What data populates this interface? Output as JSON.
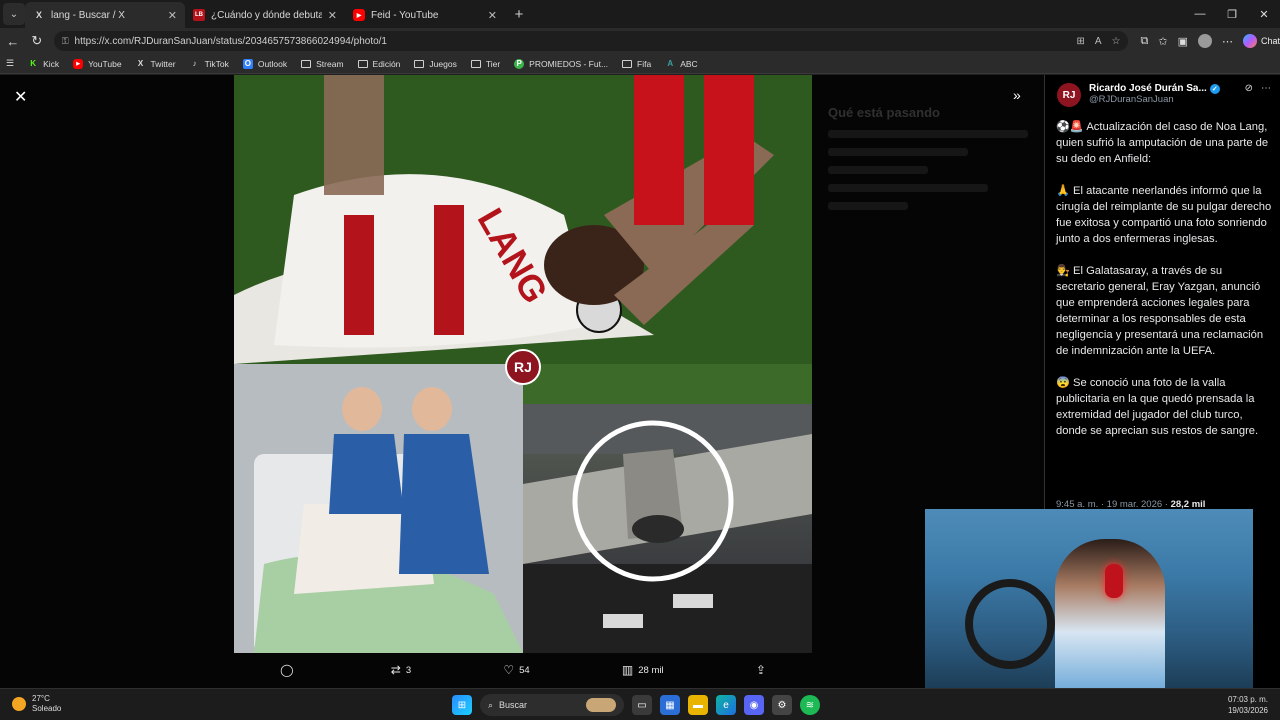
{
  "browser": {
    "tabs": [
      {
        "favicon": "x-logo-icon",
        "fav_text": "X",
        "title": "lang - Buscar / X",
        "active": true
      },
      {
        "favicon": "site-icon",
        "fav_text": "LB",
        "title": "¿Cuándo y dónde debutaría River",
        "active": false
      },
      {
        "favicon": "youtube-icon",
        "fav_text": "▶",
        "title": "Feid - YouTube",
        "active": false
      }
    ],
    "url": "https://x.com/RJDuranSanJuan/status/2034657573866024994/photo/1",
    "copilot_label": "Chat"
  },
  "bookmarks": [
    {
      "label": "Kick",
      "icon": "K",
      "color": "#53fc18"
    },
    {
      "label": "YouTube",
      "icon": "▶",
      "color": "#ff0000"
    },
    {
      "label": "Twitter",
      "icon": "X",
      "color": "#ffffff"
    },
    {
      "label": "TikTok",
      "icon": "♪",
      "color": "#ffffff"
    },
    {
      "label": "Outlook",
      "icon": "O",
      "color": "#2f7fff"
    },
    {
      "label": "Stream",
      "icon": "folder"
    },
    {
      "label": "Edición",
      "icon": "folder"
    },
    {
      "label": "Juegos",
      "icon": "folder"
    },
    {
      "label": "Tier",
      "icon": "folder"
    },
    {
      "label": "PROMIEDOS - Fut...",
      "icon": "P",
      "color": "#3bb54a"
    },
    {
      "label": "Fifa",
      "icon": "folder"
    },
    {
      "label": "ABC",
      "icon": "A",
      "color": "#3aa0a0"
    }
  ],
  "photo": {
    "badge_text": "RJ",
    "jersey_text": "LANG"
  },
  "actions": {
    "replies": "",
    "retweets": "3",
    "likes": "54",
    "views": "28 mil"
  },
  "tweet": {
    "author_name": "Ricardo José Durán Sa...",
    "author_handle": "@RJDuranSanJuan",
    "avatar_text": "RJ",
    "paragraphs": [
      "⚽🚨 Actualización del caso de Noa Lang, quien sufrió la amputación de una parte de su dedo en Anfield:",
      "🙏 El atacante neerlandés informó que la cirugía del reimplante de su pulgar derecho fue exitosa y compartió una foto sonriendo junto a dos enfermeras inglesas.",
      "👨‍⚖️ El Galatasaray, a través de su secretario general, Eray Yazgan, anunció que emprenderá acciones legales para determinar a los responsables de esta negligencia y presentará una reclamación de indemnización ante la UEFA.",
      "😨 Se conoció una foto de la valla publicitaria en la que quedó prensada la extremidad del jugador del club turco, donde se aprecian sus restos de sangre."
    ],
    "meta_time": "9:45 a. m. · 19 mar. 2026 · ",
    "meta_views": "28,2 mil"
  },
  "ghost_sidebar": {
    "heading": "Qué está pasando"
  },
  "taskbar": {
    "temperature": "27°C",
    "condition": "Soleado",
    "search_placeholder": "Buscar",
    "time": "07:03 p. m.",
    "date": "19/03/2026"
  },
  "colors": {
    "accent_verified": "#1d9bf0",
    "badge_red": "#8e1420"
  }
}
